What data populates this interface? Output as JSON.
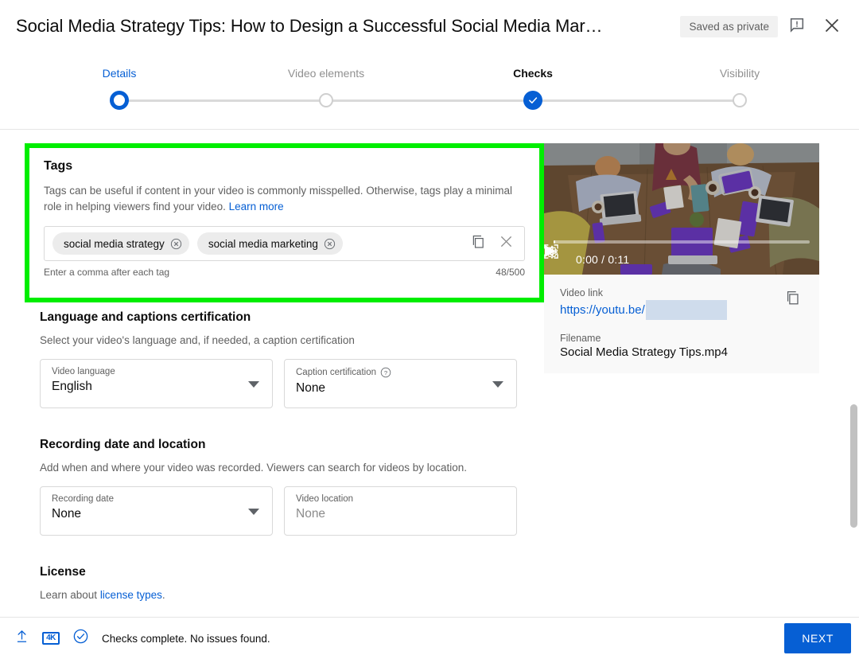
{
  "header": {
    "title": "Social Media Strategy Tips: How to Design a Successful Social Media Mar…",
    "saved_status": "Saved as private",
    "feedback_icon": "feedback-bubble-icon",
    "close_icon": "close-icon"
  },
  "stepper": {
    "steps": [
      {
        "label": "Details",
        "state": "active"
      },
      {
        "label": "Video elements",
        "state": "upcoming"
      },
      {
        "label": "Checks",
        "state": "current-done"
      },
      {
        "label": "Visibility",
        "state": "upcoming"
      }
    ]
  },
  "tags": {
    "title": "Tags",
    "description_part1": "Tags can be useful if content in your video is commonly misspelled. Otherwise, tags play a minimal role in helping viewers find your video. ",
    "learn_more": "Learn more",
    "chips": [
      {
        "label": "social media strategy"
      },
      {
        "label": "social media marketing"
      }
    ],
    "hint": "Enter a comma after each tag",
    "counter": "48/500",
    "copy_icon": "copy-icon",
    "clear_icon": "clear-x-icon",
    "highlight_color": "#00ee00"
  },
  "language_section": {
    "title": "Language and captions certification",
    "description": "Select your video's language and, if needed, a caption certification",
    "video_language": {
      "label": "Video language",
      "value": "English"
    },
    "caption_certification": {
      "label": "Caption certification",
      "value": "None",
      "help_icon": "help-circle-icon"
    }
  },
  "recording_section": {
    "title": "Recording date and location",
    "description": "Add when and where your video was recorded. Viewers can search for videos by location.",
    "recording_date": {
      "label": "Recording date",
      "value": "None"
    },
    "video_location": {
      "label": "Video location",
      "value": "None"
    }
  },
  "license_section": {
    "title": "License",
    "text_prefix": "Learn about ",
    "link": "license types",
    "text_suffix": "."
  },
  "preview": {
    "time_current": "0:00",
    "time_separator": " / ",
    "time_total": "0:11",
    "time_display": "0:00 / 0:11",
    "play_icon": "play-icon",
    "volume_icon": "volume-icon",
    "settings_icon": "gear-icon",
    "fullscreen_icon": "fullscreen-icon",
    "video_link_label": "Video link",
    "video_link_value": "https://youtu.be/",
    "filename_label": "Filename",
    "filename_value": "Social Media Strategy Tips.mp4",
    "copy_icon": "copy-icon"
  },
  "footer": {
    "upload_icon": "upload-arrow-icon",
    "resolution_badge": "4K",
    "check_icon": "check-circle-icon",
    "status": "Checks complete. No issues found.",
    "next_label": "NEXT"
  },
  "colors": {
    "accent_blue": "#065fd4",
    "highlight_green": "#00ee00",
    "muted_text": "#606060"
  }
}
